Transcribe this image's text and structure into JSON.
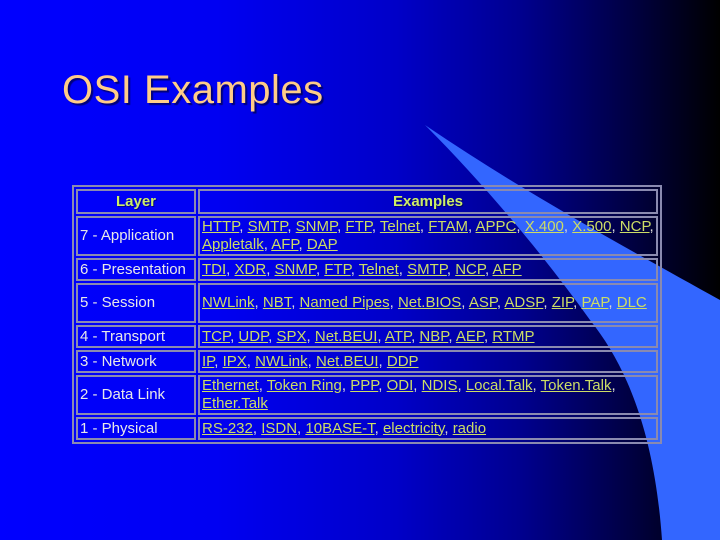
{
  "slide": {
    "title": "OSI Examples"
  },
  "colors": {
    "background_start": "#0000ff",
    "background_end": "#000000",
    "title": "#ffcc88",
    "header_text": "#ccee66",
    "layer_text": "#e8e8e8",
    "link_text": "#ccdd66",
    "swoosh": "#3366ff",
    "table_border": "#8a8ab0"
  },
  "table": {
    "headers": [
      "Layer",
      "Examples"
    ],
    "rows": [
      {
        "layer": "7 - Application",
        "examples": [
          "HTTP",
          "SMTP",
          "SNMP",
          "FTP",
          "Telnet",
          "FTAM",
          "APPC",
          "X.400",
          "X.500",
          "NCP",
          "Appletalk",
          "AFP",
          "DAP"
        ]
      },
      {
        "layer": "6 - Presentation",
        "examples": [
          "TDI",
          "XDR",
          "SNMP",
          "FTP",
          "Telnet",
          "SMTP",
          "NCP",
          "AFP"
        ]
      },
      {
        "layer": "5 - Session",
        "examples": [
          "NWLink",
          "NBT",
          "Named Pipes",
          "Net.BIOS",
          "ASP",
          "ADSP",
          "ZIP",
          "PAP",
          "DLC"
        ]
      },
      {
        "layer": "4 - Transport",
        "examples": [
          "TCP",
          "UDP",
          "SPX",
          "Net.BEUI",
          "ATP",
          "NBP",
          "AEP",
          "RTMP"
        ]
      },
      {
        "layer": "3 - Network",
        "examples": [
          "IP",
          "IPX",
          "NWLink",
          "Net.BEUI",
          "DDP"
        ]
      },
      {
        "layer": "2 - Data Link",
        "examples": [
          "Ethernet",
          "Token Ring",
          "PPP",
          "ODI",
          "NDIS",
          "Local.Talk",
          "Token.Talk",
          "Ether.Talk"
        ]
      },
      {
        "layer": "1 - Physical",
        "examples": [
          "RS-232",
          "ISDN",
          "10BASE-T",
          "electricity",
          "radio"
        ]
      }
    ]
  }
}
